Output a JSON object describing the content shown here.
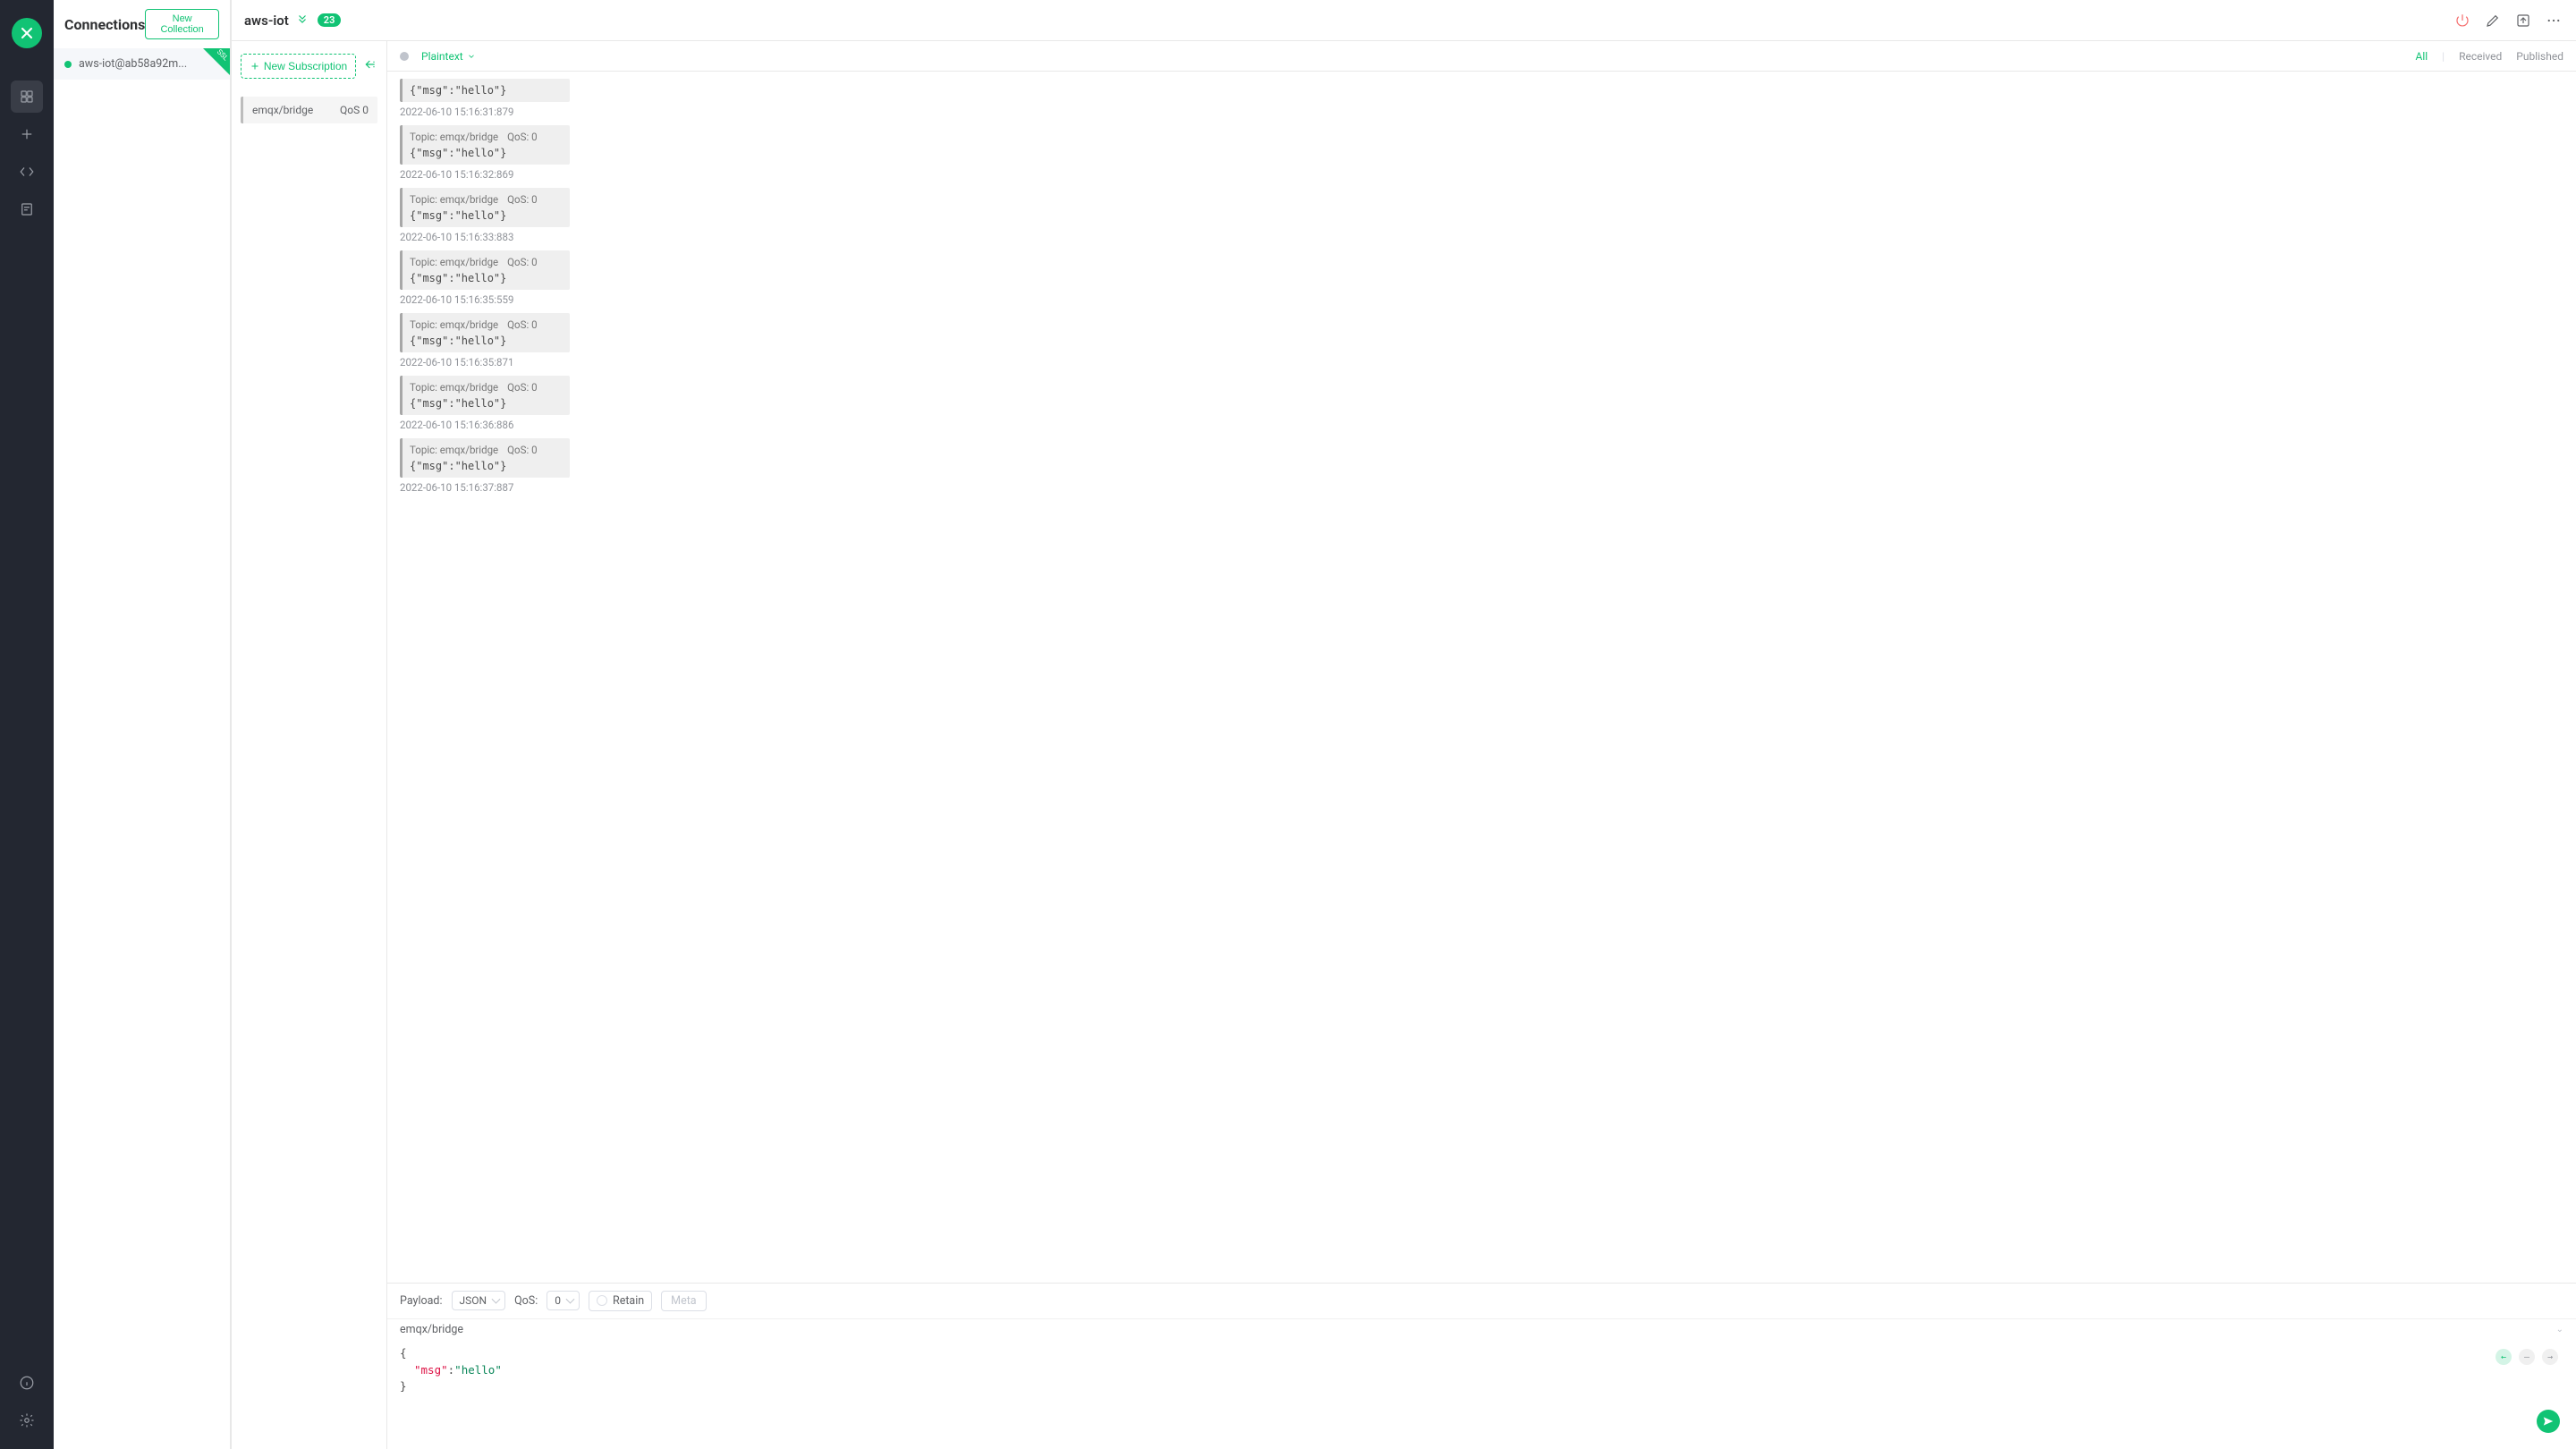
{
  "sidebar": {
    "title": "Connections",
    "new_collection_label": "New Collection",
    "connections": [
      {
        "name": "aws-iot@ab58a92m...",
        "ssl": "SSL"
      }
    ]
  },
  "topbar": {
    "title": "aws-iot",
    "unread_count": "23"
  },
  "subscriptions": {
    "new_label": "New Subscription",
    "items": [
      {
        "topic": "emqx/bridge",
        "qos": "QoS 0"
      }
    ]
  },
  "msg_toolbar": {
    "format": "Plaintext",
    "filters": {
      "all": "All",
      "received": "Received",
      "published": "Published"
    }
  },
  "messages": [
    {
      "topic": "",
      "qos": "",
      "payload": "{\"msg\":\"hello\"}",
      "time": "2022-06-10 15:16:31:879",
      "partial": true
    },
    {
      "topic": "Topic: emqx/bridge",
      "qos": "QoS: 0",
      "payload": "{\"msg\":\"hello\"}",
      "time": "2022-06-10 15:16:32:869"
    },
    {
      "topic": "Topic: emqx/bridge",
      "qos": "QoS: 0",
      "payload": "{\"msg\":\"hello\"}",
      "time": "2022-06-10 15:16:33:883"
    },
    {
      "topic": "Topic: emqx/bridge",
      "qos": "QoS: 0",
      "payload": "{\"msg\":\"hello\"}",
      "time": "2022-06-10 15:16:35:559"
    },
    {
      "topic": "Topic: emqx/bridge",
      "qos": "QoS: 0",
      "payload": "{\"msg\":\"hello\"}",
      "time": "2022-06-10 15:16:35:871"
    },
    {
      "topic": "Topic: emqx/bridge",
      "qos": "QoS: 0",
      "payload": "{\"msg\":\"hello\"}",
      "time": "2022-06-10 15:16:36:886"
    },
    {
      "topic": "Topic: emqx/bridge",
      "qos": "QoS: 0",
      "payload": "{\"msg\":\"hello\"}",
      "time": "2022-06-10 15:16:37:887"
    }
  ],
  "publish": {
    "payload_label": "Payload:",
    "payload_format": "JSON",
    "qos_label": "QoS:",
    "qos_value": "0",
    "retain_label": "Retain",
    "meta_label": "Meta",
    "topic": "emqx/bridge",
    "editor": {
      "open": "{",
      "key": "\"msg\"",
      "colon": ":",
      "val": "\"hello\"",
      "close": "}"
    }
  }
}
